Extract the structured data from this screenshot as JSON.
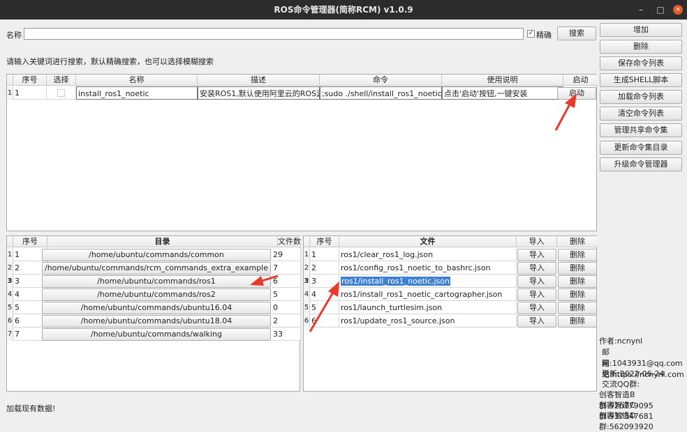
{
  "window": {
    "title": "ROS命令管理器(简称RCM) v1.0.9",
    "min": "–",
    "max": "□",
    "close": "×"
  },
  "search": {
    "label": "名称",
    "value": "",
    "precise_label": "精确",
    "precise_check": "✓",
    "button": "搜索"
  },
  "hint": "请输入关键词进行搜索，默认精确搜索，也可以选择模糊搜索",
  "side_buttons": [
    "增加",
    "删除",
    "保存命令列表",
    "生成SHELL脚本",
    "加载命令列表",
    "清空命令列表",
    "管理共享命令集",
    "更新命令集目录",
    "升级命令管理器"
  ],
  "command_table": {
    "headers": [
      "序号",
      "选择",
      "名称",
      "描述",
      "命令",
      "使用说明",
      "启动"
    ],
    "rows": [
      {
        "rownum": "1",
        "index": "1",
        "select": "",
        "name": "install_ros1_noetic",
        "desc": "安装ROS1,默认使用阿里云的ROS源",
        "cmd": ";sudo ./shell/install_ros1_noetic.sh",
        "usage": "点击'启动'按钮,一键安装",
        "launch": "启动"
      }
    ]
  },
  "dir_table": {
    "headers": [
      "序号",
      "目录",
      "文件数"
    ],
    "rows": [
      {
        "rownum": "1",
        "index": "1",
        "dir": "/home/ubuntu/commands/common",
        "count": "29"
      },
      {
        "rownum": "2",
        "index": "2",
        "dir": "/home/ubuntu/commands/rcm_commands_extra_example",
        "count": "7"
      },
      {
        "rownum": "3",
        "index": "3",
        "dir": "/home/ubuntu/commands/ros1",
        "count": "6"
      },
      {
        "rownum": "4",
        "index": "4",
        "dir": "/home/ubuntu/commands/ros2",
        "count": "5"
      },
      {
        "rownum": "5",
        "index": "5",
        "dir": "/home/ubuntu/commands/ubuntu16.04",
        "count": "0"
      },
      {
        "rownum": "6",
        "index": "6",
        "dir": "/home/ubuntu/commands/ubuntu18.04",
        "count": "2"
      },
      {
        "rownum": "7",
        "index": "7",
        "dir": "/home/ubuntu/commands/walking",
        "count": "33"
      }
    ]
  },
  "file_table": {
    "headers": [
      "序号",
      "文件",
      "导入",
      "删除"
    ],
    "rows": [
      {
        "rownum": "1",
        "index": "1",
        "file": "ros1/clear_ros1_log.json",
        "import": "导入",
        "delete": "删除"
      },
      {
        "rownum": "2",
        "index": "2",
        "file": "ros1/config_ros1_noetic_to_bashrc.json",
        "import": "导入",
        "delete": "删除"
      },
      {
        "rownum": "3",
        "index": "3",
        "file": "ros1/install_ros1_noetic.json",
        "import": "导入",
        "delete": "删除"
      },
      {
        "rownum": "4",
        "index": "4",
        "file": "ros1/install_ros1_noetic_cartographer.json",
        "import": "导入",
        "delete": "删除"
      },
      {
        "rownum": "5",
        "index": "5",
        "file": "ros1/launch_turtlesim.json",
        "import": "导入",
        "delete": "删除"
      },
      {
        "rownum": "6",
        "index": "6",
        "file": "ros1/update_ros1_source.json",
        "import": "导入",
        "delete": "删除"
      }
    ]
  },
  "status": "加载现有数据!",
  "info": [
    "作者:ncnynl",
    "邮箱:1043931@qq.com",
    "网站:https://ncnynl.com",
    "更新:2022-06-24",
    "交流QQ群:",
    "创客智造B群:926779095",
    "创客智造C群:937347681",
    "创客智造D群:562093920"
  ],
  "colors": {
    "selection": "#3d80d4",
    "arrow": "#e8392b",
    "titlebar": "#2c2c2c"
  }
}
